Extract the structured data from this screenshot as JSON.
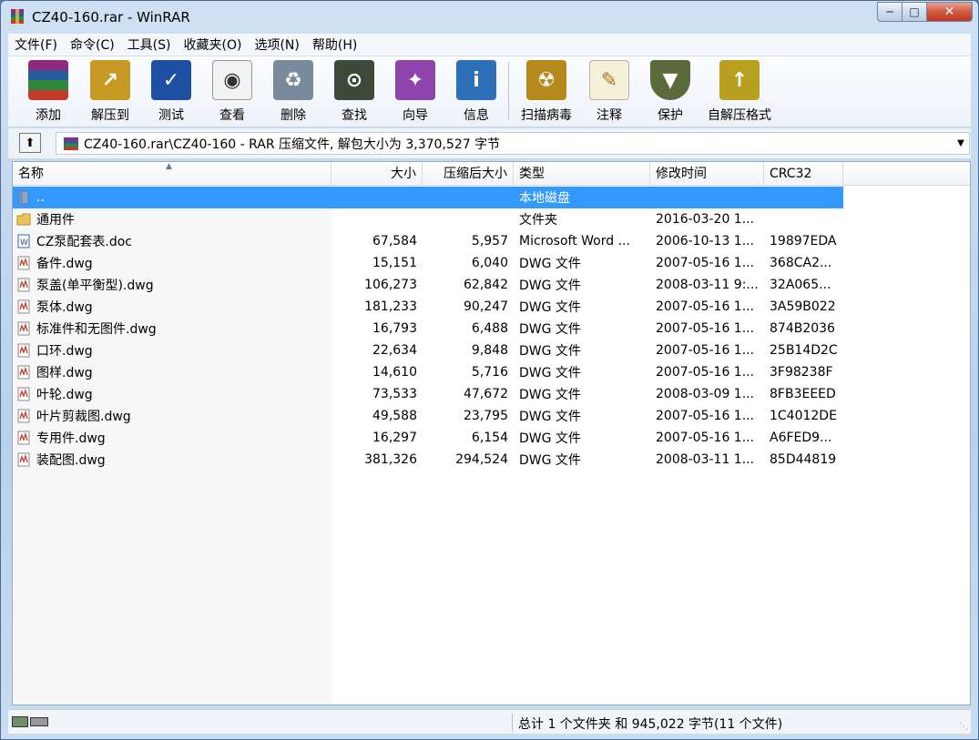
{
  "window": {
    "title": "CZ40-160.rar - WinRAR"
  },
  "menu": [
    "文件(F)",
    "命令(C)",
    "工具(S)",
    "收藏夹(O)",
    "选项(N)",
    "帮助(H)"
  ],
  "toolbar": [
    {
      "label": "添加",
      "icon": "add-archive-icon",
      "color": "#c0392b"
    },
    {
      "label": "解压到",
      "icon": "extract-to-icon",
      "color": "#c79a24"
    },
    {
      "label": "测试",
      "icon": "test-icon",
      "color": "#1f4fa3"
    },
    {
      "label": "查看",
      "icon": "view-icon",
      "color": "#9a9a9a"
    },
    {
      "label": "删除",
      "icon": "delete-icon",
      "color": "#7a8a9a"
    },
    {
      "label": "查找",
      "icon": "find-icon",
      "color": "#3d4a3a"
    },
    {
      "label": "向导",
      "icon": "wizard-icon",
      "color": "#8e44ad"
    },
    {
      "label": "信息",
      "icon": "info-icon",
      "color": "#2d6fb8"
    },
    {
      "label": "扫描病毒",
      "icon": "virus-scan-icon",
      "color": "#b58a1c"
    },
    {
      "label": "注释",
      "icon": "comment-icon",
      "color": "#d0a44a"
    },
    {
      "label": "保护",
      "icon": "protect-icon",
      "color": "#5a6a3a"
    },
    {
      "label": "自解压格式",
      "icon": "sfx-icon",
      "color": "#b9a020"
    }
  ],
  "address": {
    "text": "CZ40-160.rar\\CZ40-160 - RAR 压缩文件, 解包大小为 3,370,527 字节"
  },
  "columns": {
    "name": "名称",
    "size": "大小",
    "packed": "压缩后大小",
    "type": "类型",
    "mtime": "修改时间",
    "crc": "CRC32"
  },
  "files": [
    {
      "name": "..",
      "size": "",
      "packed": "",
      "type": "本地磁盘",
      "mtime": "",
      "crc": "",
      "icon": "parent-folder-icon",
      "selected": true
    },
    {
      "name": "通用件",
      "size": "",
      "packed": "",
      "type": "文件夹",
      "mtime": "2016-03-20 1...",
      "crc": "",
      "icon": "folder-icon"
    },
    {
      "name": "CZ泵配套表.doc",
      "size": "67,584",
      "packed": "5,957",
      "type": "Microsoft Word ...",
      "mtime": "2006-10-13 1...",
      "crc": "19897EDA",
      "icon": "word-doc-icon"
    },
    {
      "name": "备件.dwg",
      "size": "15,151",
      "packed": "6,040",
      "type": "DWG 文件",
      "mtime": "2007-05-16 1...",
      "crc": "368CA2...",
      "icon": "dwg-file-icon"
    },
    {
      "name": "泵盖(单平衡型).dwg",
      "size": "106,273",
      "packed": "62,842",
      "type": "DWG 文件",
      "mtime": "2008-03-11 9:...",
      "crc": "32A065...",
      "icon": "dwg-file-icon"
    },
    {
      "name": "泵体.dwg",
      "size": "181,233",
      "packed": "90,247",
      "type": "DWG 文件",
      "mtime": "2007-05-16 1...",
      "crc": "3A59B022",
      "icon": "dwg-file-icon"
    },
    {
      "name": "标准件和无图件.dwg",
      "size": "16,793",
      "packed": "6,488",
      "type": "DWG 文件",
      "mtime": "2007-05-16 1...",
      "crc": "874B2036",
      "icon": "dwg-file-icon"
    },
    {
      "name": "口环.dwg",
      "size": "22,634",
      "packed": "9,848",
      "type": "DWG 文件",
      "mtime": "2007-05-16 1...",
      "crc": "25B14D2C",
      "icon": "dwg-file-icon"
    },
    {
      "name": "图样.dwg",
      "size": "14,610",
      "packed": "5,716",
      "type": "DWG 文件",
      "mtime": "2007-05-16 1...",
      "crc": "3F98238F",
      "icon": "dwg-file-icon"
    },
    {
      "name": "叶轮.dwg",
      "size": "73,533",
      "packed": "47,672",
      "type": "DWG 文件",
      "mtime": "2008-03-09 1...",
      "crc": "8FB3EEED",
      "icon": "dwg-file-icon"
    },
    {
      "name": "叶片剪裁图.dwg",
      "size": "49,588",
      "packed": "23,795",
      "type": "DWG 文件",
      "mtime": "2007-05-16 1...",
      "crc": "1C4012DE",
      "icon": "dwg-file-icon"
    },
    {
      "name": "专用件.dwg",
      "size": "16,297",
      "packed": "6,154",
      "type": "DWG 文件",
      "mtime": "2007-05-16 1...",
      "crc": "A6FED9...",
      "icon": "dwg-file-icon"
    },
    {
      "name": "装配图.dwg",
      "size": "381,326",
      "packed": "294,524",
      "type": "DWG 文件",
      "mtime": "2008-03-11 1...",
      "crc": "85D44819",
      "icon": "dwg-file-icon"
    }
  ],
  "status": {
    "text": "总计 1 个文件夹 和 945,022 字节(11 个文件)"
  }
}
